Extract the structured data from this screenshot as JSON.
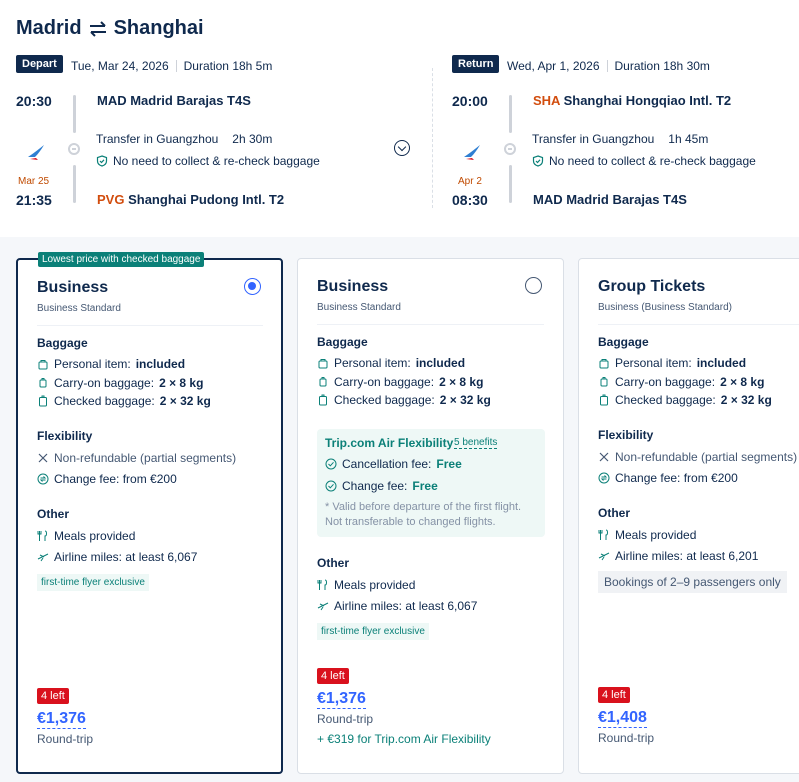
{
  "route": {
    "from": "Madrid",
    "to": "Shanghai",
    "swap_icon": "swap-arrows-icon"
  },
  "depart": {
    "badge": "Depart",
    "date": "Tue, Mar 24, 2026",
    "duration": "Duration 18h 5m",
    "dep_time": "20:30",
    "dep_airport": "MAD Madrid Barajas T4S",
    "transfer": "Transfer in Guangzhou",
    "transfer_duration": "2h 30m",
    "recheck": "No need to collect & re-check baggage",
    "arr_nextday": "Mar 25",
    "arr_time": "21:35",
    "arr_code": "PVG",
    "arr_airport": "Shanghai Pudong Intl. T2"
  },
  "return": {
    "badge": "Return",
    "date": "Wed, Apr 1, 2026",
    "duration": "Duration 18h 30m",
    "dep_time": "20:00",
    "dep_code": "SHA",
    "dep_airport": "Shanghai Hongqiao Intl. T2",
    "transfer": "Transfer in Guangzhou",
    "transfer_duration": "1h 45m",
    "recheck": "No need to collect & re-check baggage",
    "arr_nextday": "Apr 2",
    "arr_time": "08:30",
    "arr_airport": "MAD Madrid Barajas T4S"
  },
  "labels": {
    "baggage": "Baggage",
    "flexibility": "Flexibility",
    "other": "Other",
    "personal_item": "Personal item:",
    "personal_val": "included",
    "carry_on": "Carry-on baggage:",
    "carry_val": "2 × 8 kg",
    "checked": "Checked baggage:",
    "checked_val": "2 × 32 kg",
    "non_refundable": "Non-refundable (partial segments)",
    "change_fee": "Change fee: from €200",
    "meals": "Meals provided",
    "round_trip": "Round-trip"
  },
  "cards": [
    {
      "top_tag": "Lowest price with checked baggage",
      "title": "Business",
      "subtitle": "Business Standard",
      "miles": "Airline miles: at least 6,067",
      "pill": "first-time flyer exclusive",
      "left": "4 left",
      "price": "€1,376",
      "selected": true
    },
    {
      "title": "Business",
      "subtitle": "Business Standard",
      "flex_title": "Trip.com Air Flexibility",
      "flex_benefits": "5 benefits",
      "cancel_fee": "Cancellation fee:",
      "change_fee_label": "Change fee:",
      "free": "Free",
      "flex_note": "* Valid before departure of the first flight. Not transferable to changed flights.",
      "miles": "Airline miles: at least 6,067",
      "pill": "first-time flyer exclusive",
      "left": "4 left",
      "price": "€1,376",
      "addon": "+ €319 for Trip.com Air Flexibility",
      "selected": false
    },
    {
      "title": "Group Tickets",
      "subtitle": "Business (Business Standard)",
      "miles": "Airline miles: at least 6,201",
      "pill": "Bookings of 2–9 passengers only",
      "left": "4 left",
      "price": "€1,408"
    }
  ],
  "colors": {
    "navy": "#0f294d",
    "teal": "#0b8078",
    "blue": "#3264ff",
    "red": "#d9111d",
    "orange": "#d24d0e"
  }
}
